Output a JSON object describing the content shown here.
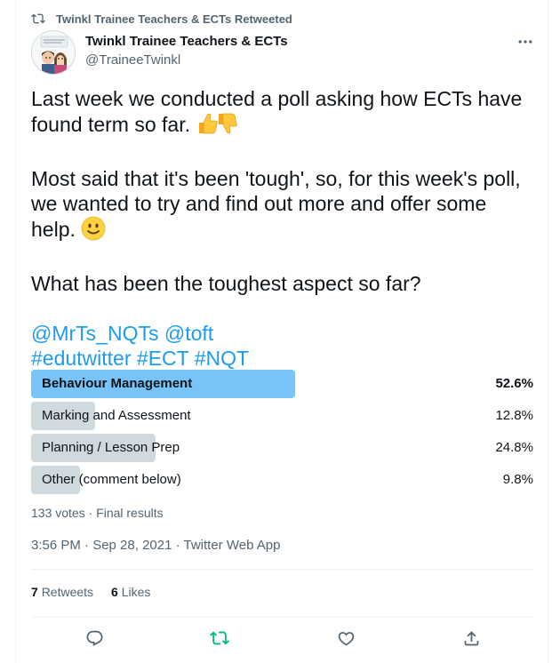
{
  "retweet_banner": {
    "text": "Twinkl Trainee Teachers & ECTs Retweeted"
  },
  "author": {
    "name": "Twinkl Trainee Teachers & ECTs",
    "handle": "@TraineeTwinkl",
    "avatar_icon": "avatar-image"
  },
  "tweet": {
    "line1a": "Last week we conducted a poll asking how ECTs have",
    "line1b": "found term so far.",
    "line2a": "Most said that it's been 'tough', so, for this week's poll,",
    "line2b": "we wanted to try and find out more and offer some",
    "line2c": "help.",
    "line3": "What has been the toughest aspect so far?",
    "mention1": "@MrTs_NQTs",
    "mention2": "@toft",
    "hashtag1": "#edutwitter",
    "hashtag2": "#ECT",
    "hashtag3": "#NQT",
    "emoji1": "thumbs-up-down-emoji",
    "emoji2": "slightly-smiling-emoji"
  },
  "poll": {
    "options": [
      {
        "label": "Behaviour Management",
        "percent_text": "52.6%",
        "percent": 52.6,
        "winner": true
      },
      {
        "label": "Marking and Assessment",
        "percent_text": "12.8%",
        "percent": 12.8,
        "winner": false
      },
      {
        "label": "Planning / Lesson Prep",
        "percent_text": "24.8%",
        "percent": 24.8,
        "winner": false
      },
      {
        "label": "Other (comment below)",
        "percent_text": "9.8%",
        "percent": 9.8,
        "winner": false
      }
    ],
    "meta": "133 votes · Final results"
  },
  "timestamp": "3:56 PM · Sep 28, 2021 · Twitter Web App",
  "stats": {
    "retweets_count": "7",
    "retweets_label": "Retweets",
    "likes_count": "6",
    "likes_label": "Likes"
  },
  "colors": {
    "link": "#1d9bf0",
    "winner_bar": "#78c3f8",
    "bar": "#cfd9de",
    "retweeted_green": "#00ba7c",
    "muted": "#536471"
  }
}
